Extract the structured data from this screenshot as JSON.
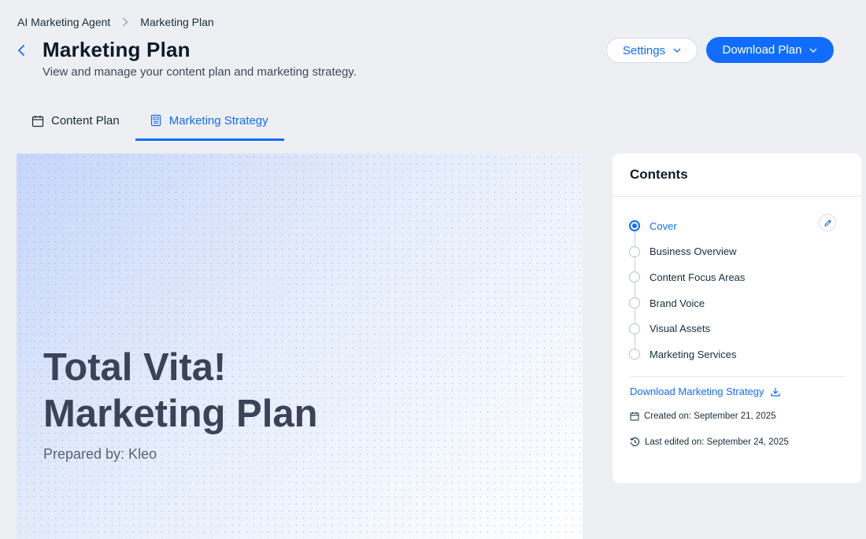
{
  "breadcrumb": {
    "parent": "AI Marketing Agent",
    "current": "Marketing Plan"
  },
  "header": {
    "title": "Marketing Plan",
    "subtitle": "View and manage your content plan and marketing strategy.",
    "settings_label": "Settings",
    "download_label": "Download Plan"
  },
  "tabs": [
    {
      "label": "Content Plan",
      "icon": "calendar-icon",
      "active": false
    },
    {
      "label": "Marketing Strategy",
      "icon": "document-icon",
      "active": true
    }
  ],
  "cover": {
    "title_line1": "Total Vita!",
    "title_line2": "Marketing Plan",
    "prepared_by": "Prepared by: Kleo"
  },
  "contents": {
    "title": "Contents",
    "items": [
      {
        "label": "Cover",
        "active": true
      },
      {
        "label": "Business Overview",
        "active": false
      },
      {
        "label": "Content Focus Areas",
        "active": false
      },
      {
        "label": "Brand Voice",
        "active": false
      },
      {
        "label": "Visual Assets",
        "active": false
      },
      {
        "label": "Marketing Services",
        "active": false
      }
    ],
    "download_link": "Download Marketing Strategy",
    "created": "Created on: September 21, 2025",
    "last_edited": "Last edited on: September 24, 2025"
  },
  "colors": {
    "accent": "#116dff",
    "background": "#eeeff3",
    "text": "#162d3d"
  }
}
